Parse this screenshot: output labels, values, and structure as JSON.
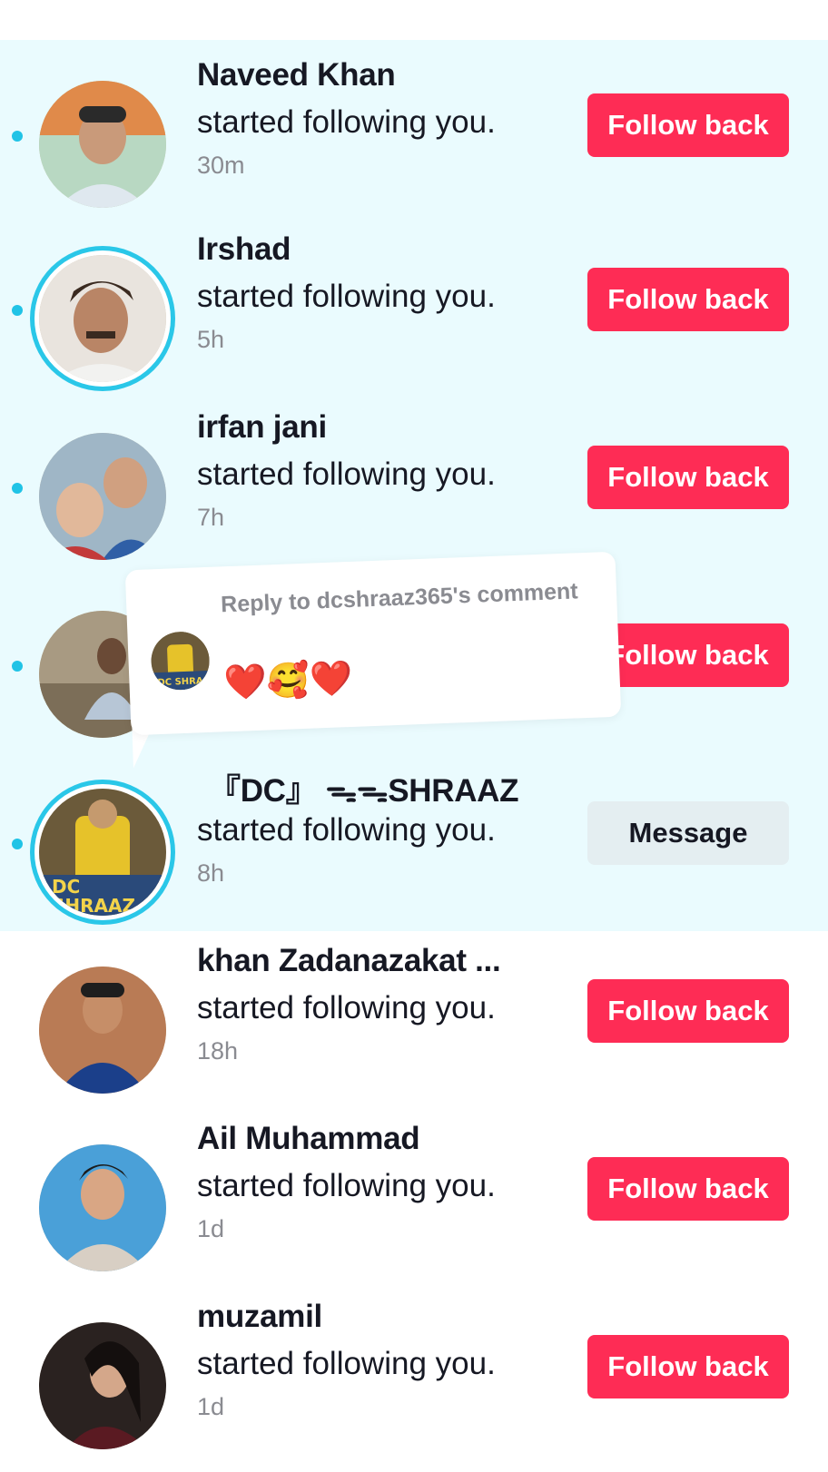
{
  "colors": {
    "unread_bg": "#eafbfe",
    "follow_back_bg": "#fe2c55",
    "message_bg": "#e4eef1",
    "unread_dot": "#20c3e6"
  },
  "notifications": [
    {
      "name": "Naveed Khan",
      "action": "started following you.",
      "time": "30m",
      "button": "Follow back",
      "unread": true
    },
    {
      "name": "Irshad",
      "action": "started following you.",
      "time": "5h",
      "button": "Follow back",
      "unread": true
    },
    {
      "name": "irfan jani",
      "action": "started following you.",
      "time": "7h",
      "button": "Follow back",
      "unread": true
    },
    {
      "name": "",
      "action": "",
      "time": "",
      "button": "Follow back",
      "unread": true
    },
    {
      "name": "『DC』 ᯓᯓSHRAAZ",
      "action": "started following you.",
      "time": "8h",
      "button": "Message",
      "unread": true
    },
    {
      "name": "khan Zadanazakat ...",
      "action": "started following you.",
      "time": "18h",
      "button": "Follow back",
      "unread": false
    },
    {
      "name": "Ail Muhammad",
      "action": "started following you.",
      "time": "1d",
      "button": "Follow back",
      "unread": false
    },
    {
      "name": "muzamil",
      "action": "started following you.",
      "time": "1d",
      "button": "Follow back",
      "unread": false
    }
  ],
  "reply_popup": {
    "title": "Reply to dcshraaz365's comment",
    "message": "❤️🥰❤️"
  }
}
